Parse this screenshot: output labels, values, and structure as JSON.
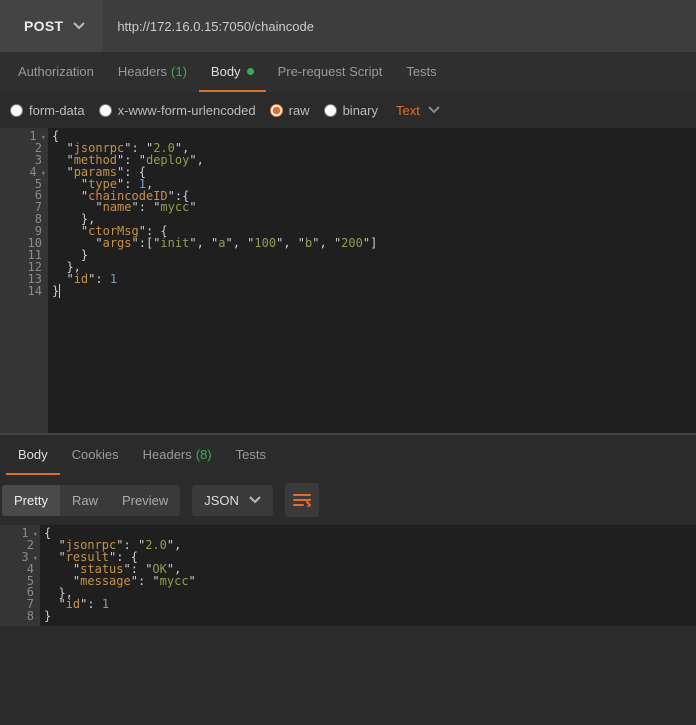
{
  "request": {
    "method": "POST",
    "url": "http://172.16.0.15:7050/chaincode",
    "tabs": {
      "authorization": "Authorization",
      "headers_label": "Headers",
      "headers_count": "(1)",
      "body": "Body",
      "prerequest": "Pre-request Script",
      "tests": "Tests"
    },
    "body_types": {
      "form_data": "form-data",
      "urlencoded": "x-www-form-urlencoded",
      "raw": "raw",
      "binary": "binary"
    },
    "raw_format": "Text",
    "editor": {
      "lines": [
        "1",
        "2",
        "3",
        "4",
        "5",
        "6",
        "7",
        "8",
        "9",
        "10",
        "11",
        "12",
        "13",
        "14"
      ],
      "body_json": {
        "jsonrpc": "2.0",
        "method": "deploy",
        "params": {
          "type": 1,
          "chaincodeID": {
            "name": "mycc"
          },
          "ctorMsg": {
            "args": [
              "init",
              "a",
              "100",
              "b",
              "200"
            ]
          }
        },
        "id": 1
      }
    }
  },
  "response": {
    "tabs": {
      "body": "Body",
      "cookies": "Cookies",
      "headers_label": "Headers",
      "headers_count": "(8)",
      "tests": "Tests"
    },
    "view": {
      "pretty": "Pretty",
      "raw": "Raw",
      "preview": "Preview",
      "format": "JSON"
    },
    "editor": {
      "lines": [
        "1",
        "2",
        "3",
        "4",
        "5",
        "6",
        "7",
        "8"
      ],
      "body_json": {
        "jsonrpc": "2.0",
        "result": {
          "status": "OK",
          "message": "mycc"
        },
        "id": 1
      }
    }
  }
}
